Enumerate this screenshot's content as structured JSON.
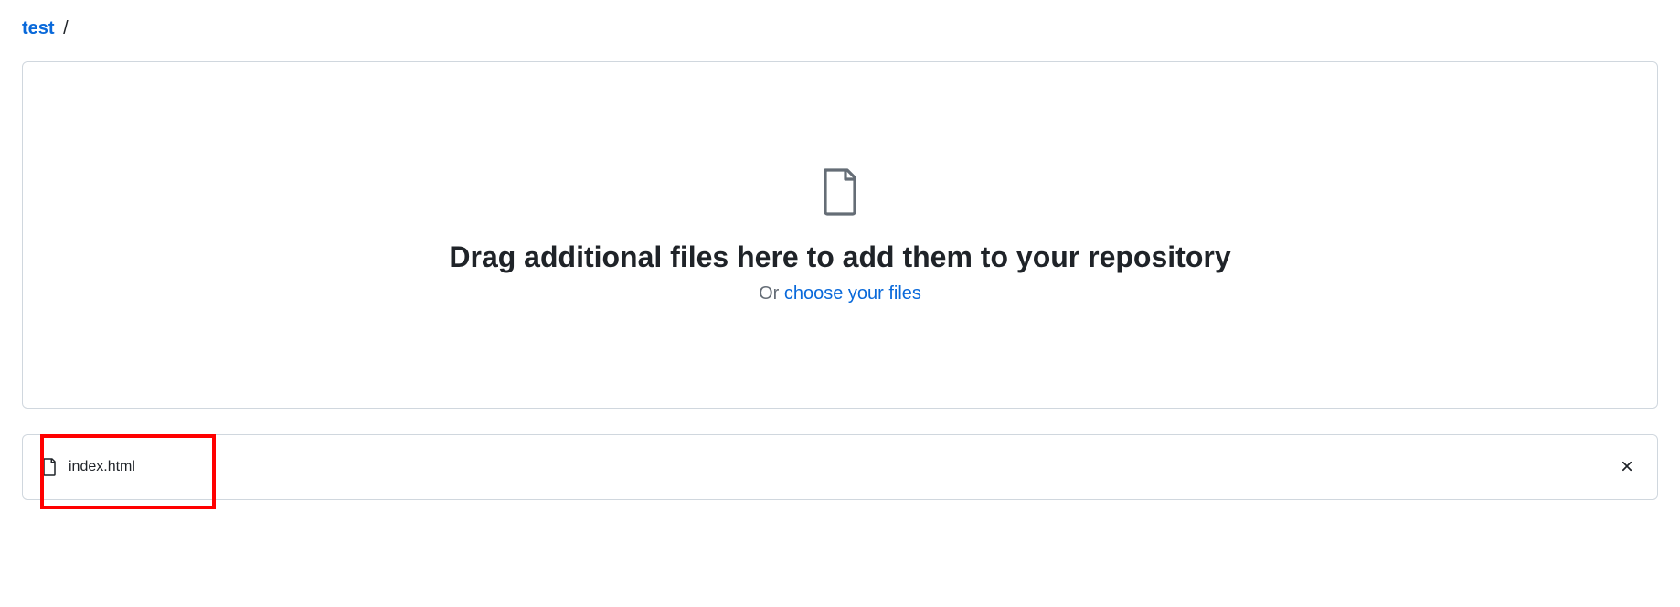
{
  "breadcrumb": {
    "repo": "test",
    "separator": "/"
  },
  "dropzone": {
    "heading": "Drag additional files here to add them to your repository",
    "or_prefix": "Or ",
    "choose_link": "choose your files"
  },
  "files": [
    {
      "name": "index.html"
    }
  ]
}
